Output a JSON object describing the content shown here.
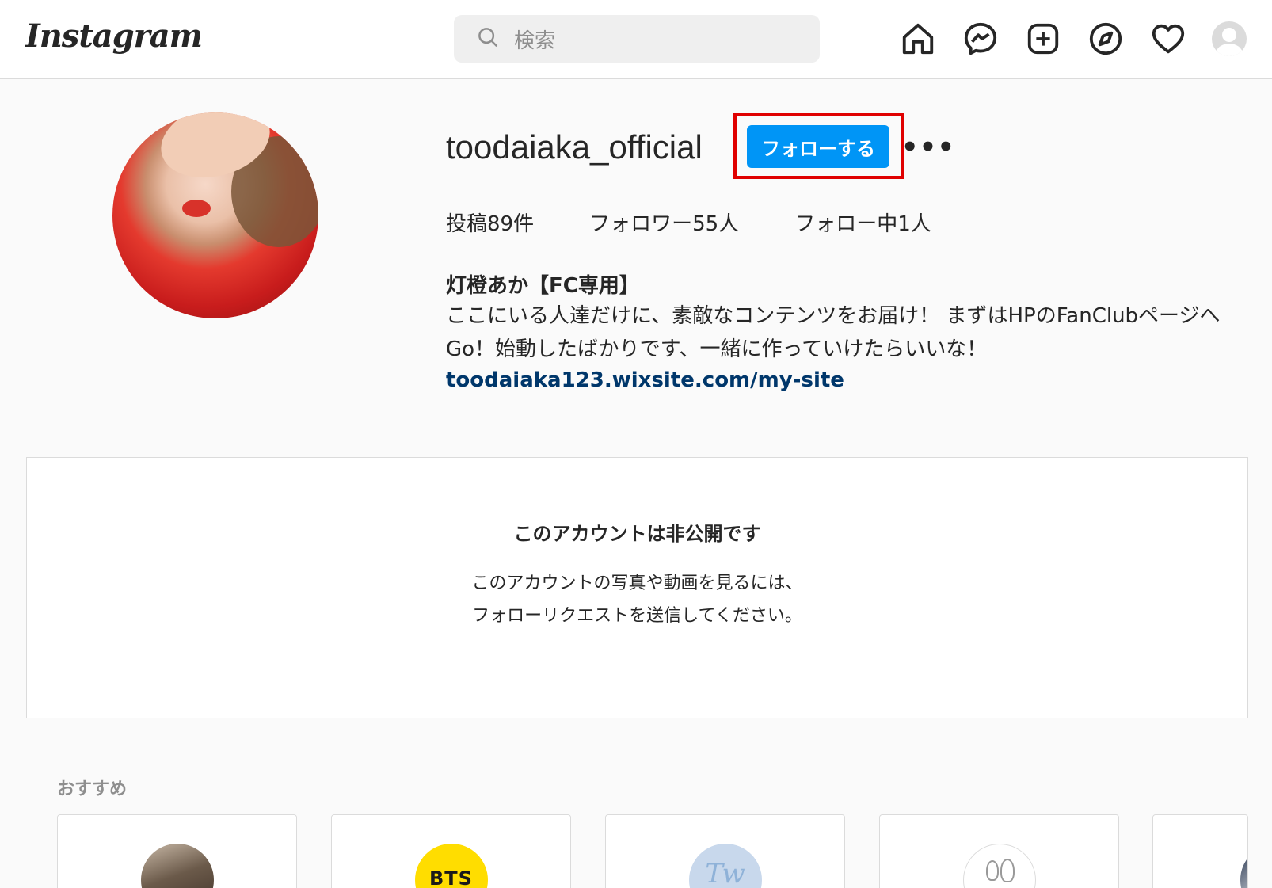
{
  "app": {
    "logo_text": "Instagram"
  },
  "search": {
    "placeholder": "検索"
  },
  "nav": {
    "icons": [
      "home-icon",
      "messenger-icon",
      "new-post-icon",
      "explore-icon",
      "activity-heart-icon",
      "profile-avatar-icon"
    ]
  },
  "profile": {
    "username": "toodaiaka_official",
    "follow_label": "フォローする",
    "more_label": "•••",
    "stats": {
      "posts": "投稿89件",
      "followers": "フォロワー55人",
      "following": "フォロー中1人"
    },
    "bio": {
      "name": "灯橙あか【FC専用】",
      "text": "ここにいる人達だけに、素敵なコンテンツをお届け！ まずはHPのFanClubページへGo！始動したばかりです、一緒に作っていけたらいいな！",
      "link": "toodaiaka123.wixsite.com/my-site"
    }
  },
  "private_notice": {
    "title": "このアカウントは非公開です",
    "description": "このアカウントの写真や動画を見るには、フォローリクエストを送信してください。"
  },
  "suggestions": {
    "title": "おすすめ",
    "cards": [
      {
        "avatar_text": ""
      },
      {
        "avatar_text": "BTS"
      },
      {
        "avatar_text": "Tw"
      },
      {
        "avatar_text": ""
      },
      {
        "avatar_text": ""
      }
    ]
  },
  "colors": {
    "follow_button": "#0095f6",
    "highlight_box": "#e00000",
    "link": "#00376b",
    "background": "#fafafa"
  }
}
